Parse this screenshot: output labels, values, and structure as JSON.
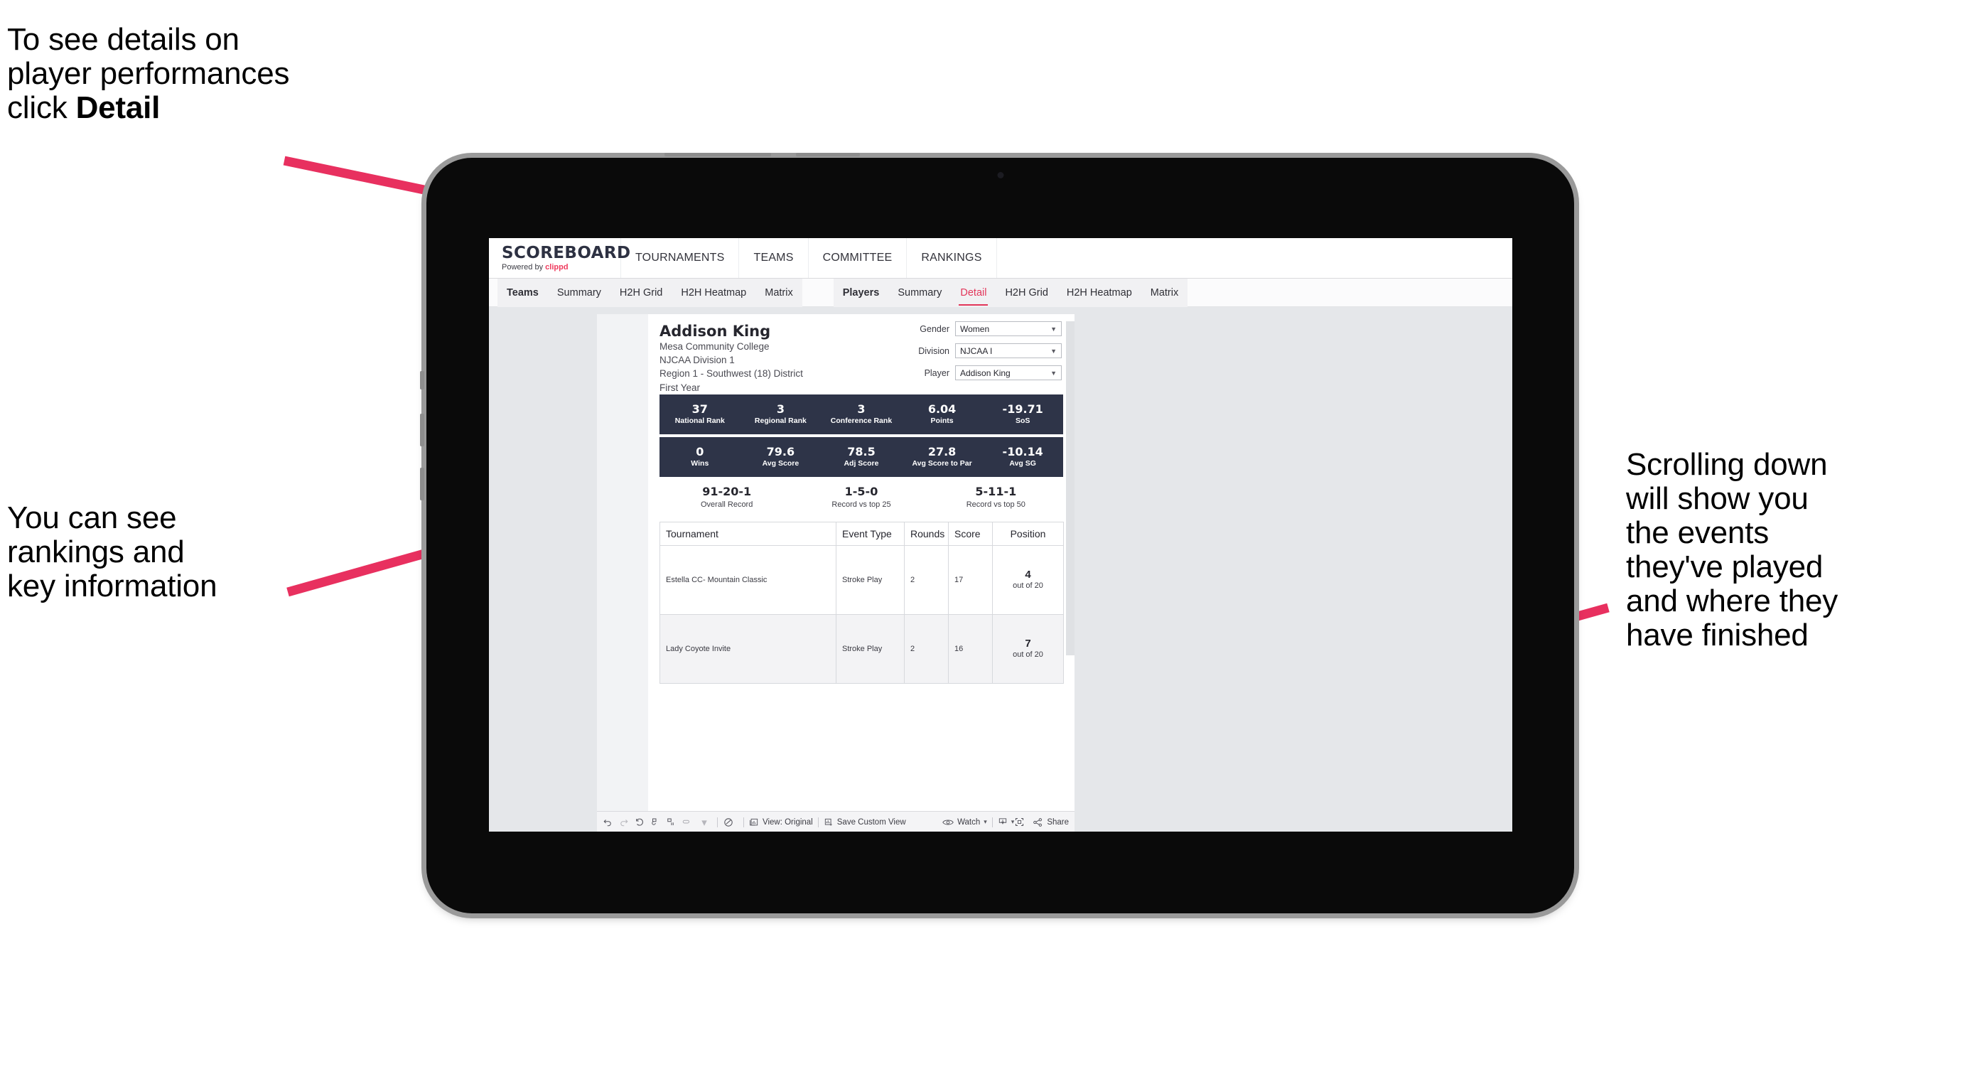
{
  "annotations": {
    "top_left": "To see details on\nplayer performances\nclick ",
    "top_left_bold": "Detail",
    "mid_left": "You can see\nrankings and\nkey information",
    "right": "Scrolling down\nwill show you\nthe events\nthey've played\nand where they\nhave finished",
    "arrow_color": "#e8305f"
  },
  "app": {
    "brand": {
      "title": "SCOREBOARD",
      "powered_prefix": "Powered by ",
      "powered_brand": "clippd"
    },
    "top_nav": [
      "TOURNAMENTS",
      "TEAMS",
      "COMMITTEE",
      "RANKINGS"
    ],
    "tabs_teams": [
      "Teams",
      "Summary",
      "H2H Grid",
      "H2H Heatmap",
      "Matrix"
    ],
    "tabs_players": [
      "Players",
      "Summary",
      "Detail",
      "H2H Grid",
      "H2H Heatmap",
      "Matrix"
    ],
    "active_tab": "Detail"
  },
  "player": {
    "name": "Addison King",
    "school": "Mesa Community College",
    "division": "NJCAA Division 1",
    "region": "Region 1 - Southwest (18) District",
    "year": "First Year"
  },
  "filters": [
    {
      "label": "Gender",
      "value": "Women"
    },
    {
      "label": "Division",
      "value": "NJCAA I"
    },
    {
      "label": "Player",
      "value": "Addison King"
    }
  ],
  "stats_row1": [
    {
      "value": "37",
      "label": "National Rank"
    },
    {
      "value": "3",
      "label": "Regional Rank"
    },
    {
      "value": "3",
      "label": "Conference Rank"
    },
    {
      "value": "6.04",
      "label": "Points"
    },
    {
      "value": "-19.71",
      "label": "SoS"
    }
  ],
  "stats_row2": [
    {
      "value": "0",
      "label": "Wins"
    },
    {
      "value": "79.6",
      "label": "Avg Score"
    },
    {
      "value": "78.5",
      "label": "Adj Score"
    },
    {
      "value": "27.8",
      "label": "Avg Score to Par"
    },
    {
      "value": "-10.14",
      "label": "Avg SG"
    }
  ],
  "records": [
    {
      "value": "91-20-1",
      "label": "Overall Record"
    },
    {
      "value": "1-5-0",
      "label": "Record vs top 25"
    },
    {
      "value": "5-11-1",
      "label": "Record vs top 50"
    }
  ],
  "table": {
    "columns": [
      "Tournament",
      "Event Type",
      "Rounds",
      "Score",
      "Position"
    ],
    "rows": [
      {
        "tournament": "Estella CC- Mountain Classic",
        "event_type": "Stroke Play",
        "rounds": "2",
        "score": "17",
        "position": "4",
        "position_of": "out of 20"
      },
      {
        "tournament": "Lady Coyote Invite",
        "event_type": "Stroke Play",
        "rounds": "2",
        "score": "16",
        "position": "7",
        "position_of": "out of 20"
      }
    ]
  },
  "toolbar": {
    "view_label": "View: Original",
    "save_label": "Save Custom View",
    "watch_label": "Watch",
    "share_label": "Share"
  }
}
